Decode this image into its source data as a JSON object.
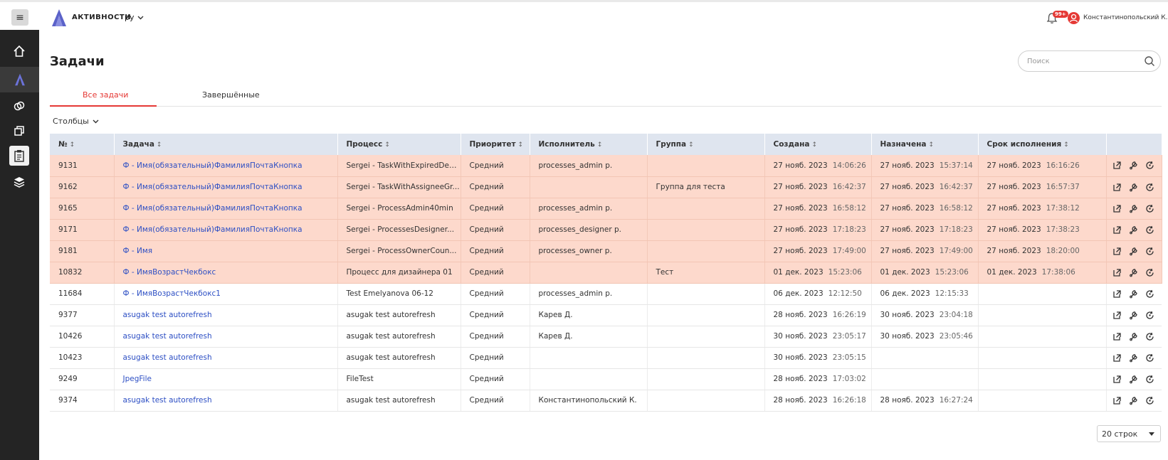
{
  "header": {
    "menu_icon": "hamburger-icon",
    "app_title": "АКТИВНОСТИ",
    "language": "ру",
    "notifications_badge": "99+",
    "user_name": "Константинопольский К."
  },
  "page": {
    "title": "Задачи",
    "search_placeholder": "Поиск",
    "columns_label": "Столбцы",
    "rows_per_page": "20 строк"
  },
  "tabs": [
    {
      "label": "Все задачи",
      "active": true
    },
    {
      "label": "Завершённые",
      "active": false
    }
  ],
  "sidebar": {
    "items": [
      "home-icon",
      "activities-logo-icon",
      "link-icon",
      "copy-icon",
      "clipboard-icon",
      "layers-icon"
    ]
  },
  "colors": {
    "accent": "#e53935",
    "overdue_row": "#fdd9cc",
    "link": "#2d4fc4",
    "header_bg": "#dfe5ef",
    "sidebar_bg": "#242424"
  },
  "table": {
    "columns": [
      "№",
      "Задача",
      "Процесс",
      "Приоритет",
      "Исполнитель",
      "Группа",
      "Создана",
      "Назначена",
      "Срок исполнения"
    ],
    "rows": [
      {
        "id": "9131",
        "task": "Ф - Имя(обязательный)ФамилияПочтаКнопка",
        "process": "Sergei - TaskWithExpiredDea...",
        "priority": "Средний",
        "assignee": "processes_admin p.",
        "group": "",
        "created_d": "27 нояб. 2023",
        "created_t": "14:06:26",
        "assigned_d": "27 нояб. 2023",
        "assigned_t": "15:37:14",
        "due_d": "27 нояб. 2023",
        "due_t": "16:16:26",
        "overdue": true
      },
      {
        "id": "9162",
        "task": "Ф - Имя(обязательный)ФамилияПочтаКнопка",
        "process": "Sergei - TaskWithAssigneeGr...",
        "priority": "Средний",
        "assignee": "",
        "group": "Группа для теста",
        "created_d": "27 нояб. 2023",
        "created_t": "16:42:37",
        "assigned_d": "27 нояб. 2023",
        "assigned_t": "16:42:37",
        "due_d": "27 нояб. 2023",
        "due_t": "16:57:37",
        "overdue": true
      },
      {
        "id": "9165",
        "task": "Ф - Имя(обязательный)ФамилияПочтаКнопка",
        "process": "Sergei - ProcessAdmin40min",
        "priority": "Средний",
        "assignee": "processes_admin p.",
        "group": "",
        "created_d": "27 нояб. 2023",
        "created_t": "16:58:12",
        "assigned_d": "27 нояб. 2023",
        "assigned_t": "16:58:12",
        "due_d": "27 нояб. 2023",
        "due_t": "17:38:12",
        "overdue": true
      },
      {
        "id": "9171",
        "task": "Ф - Имя(обязательный)ФамилияПочтаКнопка",
        "process": "Sergei - ProcessesDesigner...",
        "priority": "Средний",
        "assignee": "processes_designer p.",
        "group": "",
        "created_d": "27 нояб. 2023",
        "created_t": "17:18:23",
        "assigned_d": "27 нояб. 2023",
        "assigned_t": "17:18:23",
        "due_d": "27 нояб. 2023",
        "due_t": "17:38:23",
        "overdue": true
      },
      {
        "id": "9181",
        "task": "Ф - Имя",
        "process": "Sergei - ProcessOwnerCoun...",
        "priority": "Средний",
        "assignee": "processes_owner p.",
        "group": "",
        "created_d": "27 нояб. 2023",
        "created_t": "17:49:00",
        "assigned_d": "27 нояб. 2023",
        "assigned_t": "17:49:00",
        "due_d": "27 нояб. 2023",
        "due_t": "18:20:00",
        "overdue": true
      },
      {
        "id": "10832",
        "task": "Ф - ИмяВозрастЧекбокс",
        "process": "Процесс для дизайнера 01",
        "priority": "Средний",
        "assignee": "",
        "group": "Тест",
        "created_d": "01 дек. 2023",
        "created_t": "15:23:06",
        "assigned_d": "01 дек. 2023",
        "assigned_t": "15:23:06",
        "due_d": "01 дек. 2023",
        "due_t": "17:38:06",
        "overdue": true
      },
      {
        "id": "11684",
        "task": "Ф - ИмяВозрастЧекбокс1",
        "process": "Test Emelyanova 06-12",
        "priority": "Средний",
        "assignee": "processes_admin p.",
        "group": "",
        "created_d": "06 дек. 2023",
        "created_t": "12:12:50",
        "assigned_d": "06 дек. 2023",
        "assigned_t": "12:15:33",
        "due_d": "",
        "due_t": "",
        "overdue": false
      },
      {
        "id": "9377",
        "task": "asugak test autorefresh",
        "process": "asugak test autorefresh",
        "priority": "Средний",
        "assignee": "Карев Д.",
        "group": "",
        "created_d": "28 нояб. 2023",
        "created_t": "16:26:19",
        "assigned_d": "30 нояб. 2023",
        "assigned_t": "23:04:18",
        "due_d": "",
        "due_t": "",
        "overdue": false
      },
      {
        "id": "10426",
        "task": "asugak test autorefresh",
        "process": "asugak test autorefresh",
        "priority": "Средний",
        "assignee": "Карев Д.",
        "group": "",
        "created_d": "30 нояб. 2023",
        "created_t": "23:05:17",
        "assigned_d": "30 нояб. 2023",
        "assigned_t": "23:05:46",
        "due_d": "",
        "due_t": "",
        "overdue": false
      },
      {
        "id": "10423",
        "task": "asugak test autorefresh",
        "process": "asugak test autorefresh",
        "priority": "Средний",
        "assignee": "",
        "group": "",
        "created_d": "30 нояб. 2023",
        "created_t": "23:05:15",
        "assigned_d": "",
        "assigned_t": "",
        "due_d": "",
        "due_t": "",
        "overdue": false
      },
      {
        "id": "9249",
        "task": "JpegFile",
        "process": "FileTest",
        "priority": "Средний",
        "assignee": "",
        "group": "",
        "created_d": "28 нояб. 2023",
        "created_t": "17:03:02",
        "assigned_d": "",
        "assigned_t": "",
        "due_d": "",
        "due_t": "",
        "overdue": false
      },
      {
        "id": "9374",
        "task": "asugak test autorefresh",
        "process": "asugak test autorefresh",
        "priority": "Средний",
        "assignee": "Константинопольский К.",
        "group": "",
        "created_d": "28 нояб. 2023",
        "created_t": "16:26:18",
        "assigned_d": "28 нояб. 2023",
        "assigned_t": "16:27:24",
        "due_d": "",
        "due_t": "",
        "overdue": false
      }
    ]
  }
}
